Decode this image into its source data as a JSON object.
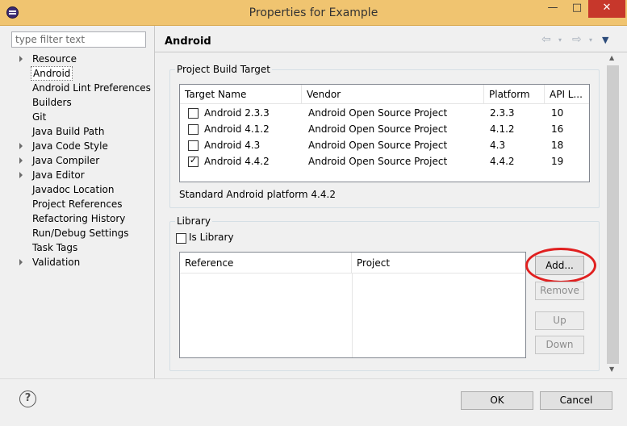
{
  "window": {
    "title": "Properties for Example",
    "minimize": "—",
    "maximize": "□",
    "close": "✕"
  },
  "filter": {
    "placeholder": "type filter text",
    "value": ""
  },
  "tree": [
    {
      "label": "Resource",
      "expandable": true
    },
    {
      "label": "Android",
      "expandable": false,
      "selected": true
    },
    {
      "label": "Android Lint Preferences",
      "expandable": false
    },
    {
      "label": "Builders",
      "expandable": false
    },
    {
      "label": "Git",
      "expandable": false
    },
    {
      "label": "Java Build Path",
      "expandable": false
    },
    {
      "label": "Java Code Style",
      "expandable": true
    },
    {
      "label": "Java Compiler",
      "expandable": true
    },
    {
      "label": "Java Editor",
      "expandable": true
    },
    {
      "label": "Javadoc Location",
      "expandable": false
    },
    {
      "label": "Project References",
      "expandable": false
    },
    {
      "label": "Refactoring History",
      "expandable": false
    },
    {
      "label": "Run/Debug Settings",
      "expandable": false
    },
    {
      "label": "Task Tags",
      "expandable": false
    },
    {
      "label": "Validation",
      "expandable": true
    }
  ],
  "page": {
    "title": "Android",
    "nav": {
      "back": "⇦",
      "forward": "⇨",
      "dropdown": "▾",
      "menu": "▼"
    }
  },
  "build_target": {
    "group_label": "Project Build Target",
    "columns": [
      "Target Name",
      "Vendor",
      "Platform",
      "API L..."
    ],
    "rows": [
      {
        "checked": false,
        "name": "Android 2.3.3",
        "vendor": "Android Open Source Project",
        "platform": "2.3.3",
        "api": "10"
      },
      {
        "checked": false,
        "name": "Android 4.1.2",
        "vendor": "Android Open Source Project",
        "platform": "4.1.2",
        "api": "16"
      },
      {
        "checked": false,
        "name": "Android 4.3",
        "vendor": "Android Open Source Project",
        "platform": "4.3",
        "api": "18"
      },
      {
        "checked": true,
        "name": "Android 4.4.2",
        "vendor": "Android Open Source Project",
        "platform": "4.4.2",
        "api": "19"
      }
    ],
    "status": "Standard Android platform 4.4.2"
  },
  "library": {
    "group_label": "Library",
    "is_library_label": "Is Library",
    "is_library_checked": false,
    "columns": [
      "Reference",
      "Project"
    ],
    "buttons": {
      "add": "Add...",
      "remove": "Remove",
      "up": "Up",
      "down": "Down"
    }
  },
  "footer": {
    "help": "?",
    "ok": "OK",
    "cancel": "Cancel"
  },
  "scrollbar": {
    "up": "▲",
    "down": "▼"
  },
  "colors": {
    "titlebar": "#f0c470",
    "close": "#c7372b",
    "highlight": "#e02020"
  },
  "icons": {
    "app": "eclipse-icon",
    "help": "help-icon"
  }
}
